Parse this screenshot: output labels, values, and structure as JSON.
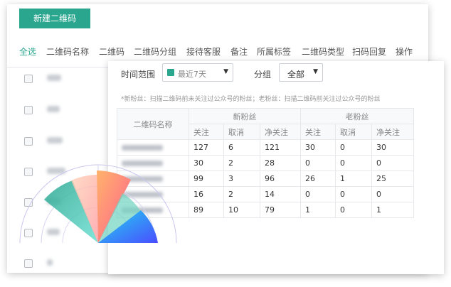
{
  "back_panel": {
    "new_button": "新建二维码",
    "columns": [
      "全选",
      "二维码名称",
      "二维码",
      "二维码分组",
      "接待客服",
      "备注",
      "所属标签",
      "二维码类型",
      "扫码回复",
      "操作"
    ]
  },
  "front_panel": {
    "time_range_label": "时间范围",
    "time_range_value": "最近7天",
    "group_label": "分组",
    "group_value": "全部",
    "note": "*新粉丝：扫描二维码前未关注过公众号的粉丝；老粉丝：扫描二维码前关注过公众号的粉丝",
    "table": {
      "name_header": "二维码名称",
      "new_fans_header": "新粉丝",
      "old_fans_header": "老粉丝",
      "sub_headers": [
        "关注",
        "取消",
        "净关注",
        "关注",
        "取消",
        "净关注"
      ],
      "rows": [
        [
          "127",
          "6",
          "121",
          "30",
          "0",
          "30"
        ],
        [
          "30",
          "2",
          "28",
          "0",
          "0",
          "0"
        ],
        [
          "99",
          "3",
          "96",
          "26",
          "1",
          "25"
        ],
        [
          "16",
          "2",
          "14",
          "0",
          "0",
          "0"
        ],
        [
          "89",
          "10",
          "79",
          "1",
          "0",
          "1"
        ]
      ]
    }
  },
  "decoration_colors": {
    "teal": "#2aa58e",
    "orange": "#ff9a6b",
    "pink": "#ff6f91",
    "blue": "#4d62ff",
    "cyan": "#35d0e0"
  }
}
